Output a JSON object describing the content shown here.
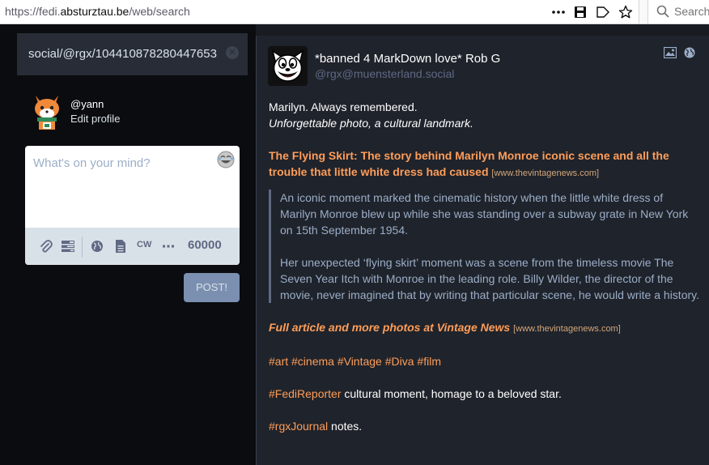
{
  "browser": {
    "url_prefix": "https://fedi.",
    "url_host": "absturztau.be",
    "url_path": "/web/search",
    "search_placeholder": "Search",
    "icons": [
      "more-icon",
      "save-icon",
      "bookmark-icon",
      "star-icon",
      "search-icon"
    ]
  },
  "sidebar": {
    "search_value": "social/@rgx/104410878280447653",
    "account_handle": "@yann",
    "edit_profile": "Edit profile"
  },
  "compose": {
    "placeholder": "What's on your mind?",
    "cw_label": "CW",
    "char_count": "60000",
    "post_label": "POST!",
    "tools": [
      "paperclip-icon",
      "poll-icon",
      "globe-icon",
      "file-icon",
      "cw-toggle",
      "more-icon"
    ]
  },
  "status": {
    "display_name": "*banned 4 MarkDown love* Rob G",
    "acct": "@rgx@muensterland.social",
    "line1": "Marilyn. Always remembered.",
    "line2": "Unforgettable photo, a cultural landmark.",
    "heading": "The Flying Skirt: The story behind Marilyn Monroe iconic scene and all the trouble that little white dress had caused",
    "heading_link": "[www.thevintagenews.com]",
    "quote_p1": "An iconic moment marked the cinematic history when the little white dress of Marilyn Monroe blew up while she was standing over a subway grate in New York on 15th September 1954.",
    "quote_p2": "Her unexpected ‘flying skirt’ moment was a scene from the timeless movie The Seven Year Itch with Monroe in the leading role. Billy Wilder, the director of the movie, never imagined that by writing that particular scene, he would write a history.",
    "full_article": "Full article and more photos at Vintage News",
    "full_article_link": "[www.thevintagenews.com]",
    "tags": [
      "#art",
      "#cinema",
      "#Vintage",
      "#Diva",
      "#film"
    ],
    "fedireporter_tag": "#FediReporter",
    "fedireporter_text": " cultural moment, homage to a beloved star.",
    "journal_tag": "#rgxJournal",
    "journal_text": " notes."
  },
  "colors": {
    "accent_orange": "#fe9d59",
    "link_tan": "#d2a679",
    "background": "#191b22",
    "panel": "#282c37"
  }
}
